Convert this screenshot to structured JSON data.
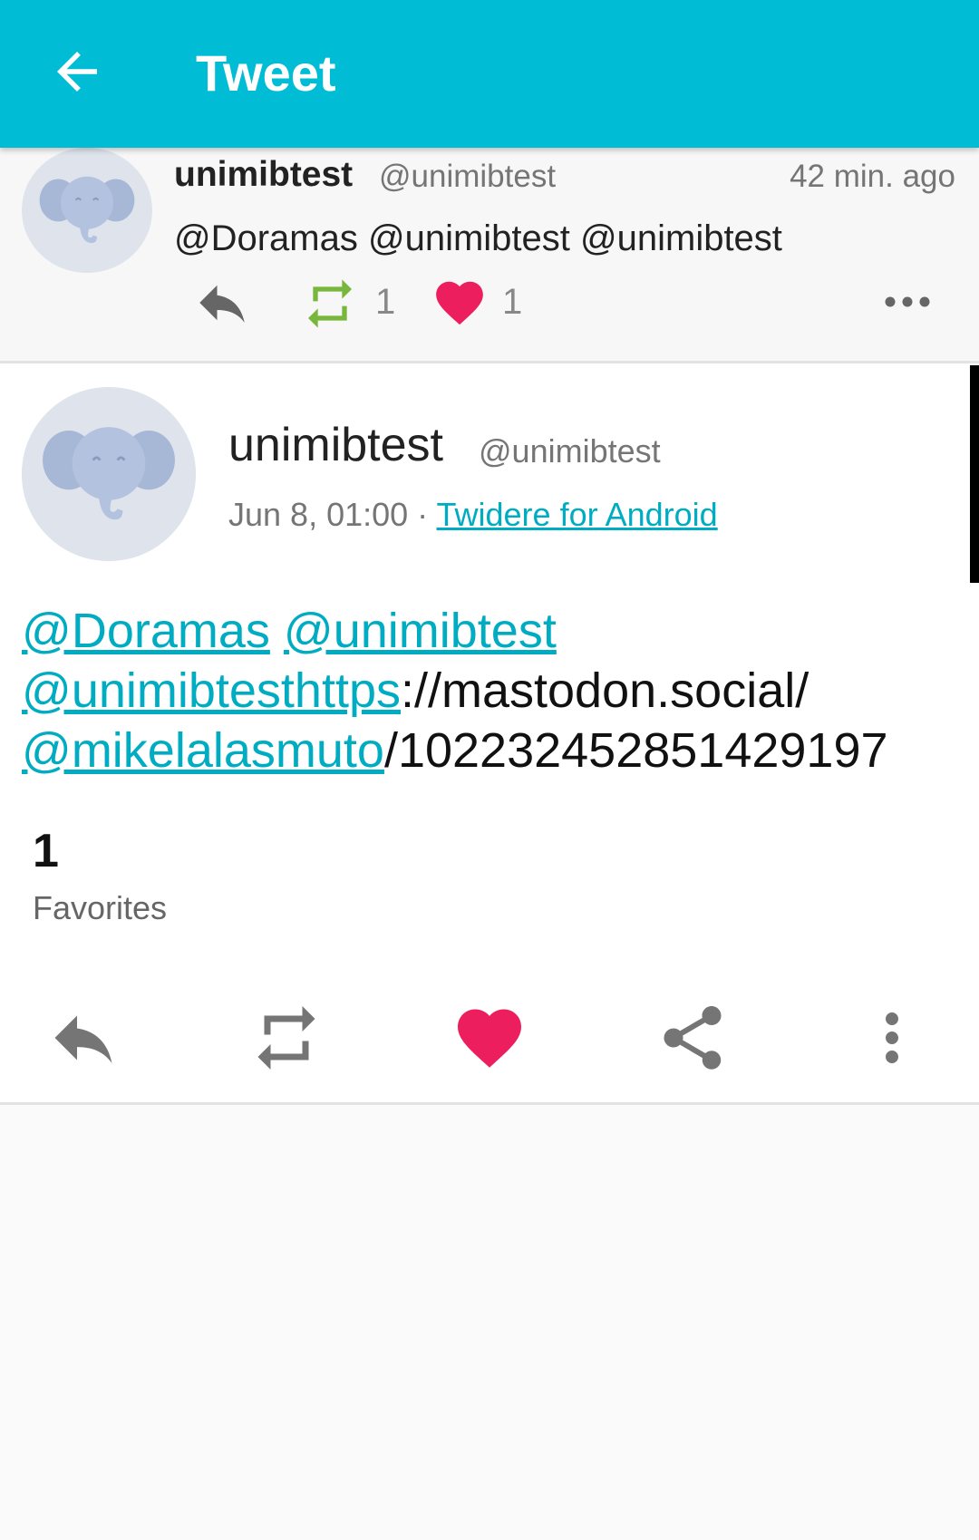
{
  "appbar": {
    "title": "Tweet"
  },
  "reply": {
    "name": "unimibtest",
    "handle": "@unimibtest",
    "time": "42 min. ago",
    "text": "@Doramas @unimibtest @unimibtest",
    "retweet_count": "1",
    "favorite_count": "1"
  },
  "status": {
    "name": "unimibtest",
    "handle": "@unimibtest",
    "date": "Jun 8, 01:00",
    "separator": " · ",
    "source": "Twidere for Android",
    "body": [
      {
        "text": "@Doramas",
        "link": true
      },
      {
        "text": " ",
        "link": false
      },
      {
        "text": "@unimibtest",
        "link": true
      },
      {
        "text": " ",
        "link": false
      },
      {
        "text": "@unimibtesthttps",
        "link": true
      },
      {
        "text": "://mastodon.social/",
        "link": false
      },
      {
        "text": "@mikelalasmuto",
        "link": true
      },
      {
        "text": "/102232452851429197",
        "link": false
      }
    ],
    "favorites_count": "1",
    "favorites_label": "Favorites"
  },
  "icons": {
    "back": "arrow-back-icon",
    "reply": "reply-icon",
    "retweet": "retweet-icon",
    "favorite": "heart-icon",
    "share": "share-icon",
    "more": "more-vertical-icon",
    "more_horizontal": "more-horizontal-icon"
  },
  "colors": {
    "appbar": "#00bcd4",
    "link": "#00acc1",
    "favorite": "#ec1e5d",
    "retweet": "#78b73b",
    "icon_gray": "#757575"
  }
}
